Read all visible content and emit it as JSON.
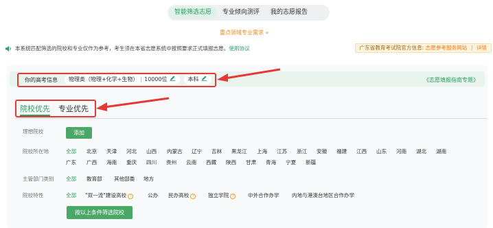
{
  "top_tabs": [
    {
      "label": "智能筛选志愿",
      "active": true
    },
    {
      "label": "专业倾向测评",
      "active": false
    },
    {
      "label": "我的志愿报告",
      "active": false
    }
  ],
  "promo_text": "重点领域专业需求 »",
  "notice": {
    "text": "本系统匹配筛选的院校和专业仅作为参考，考生须在本省志愿系统中按照要求正式填报志愿。",
    "link": "使用协议"
  },
  "official": {
    "prefix": "广东省教育考试院官方信息:",
    "link1": "志愿参考服务网站",
    "sep": "|",
    "link2": "详情"
  },
  "exam_info": {
    "label": "你的高考信息",
    "subject": "物理类（物理+化学+生物）",
    "sep": "|",
    "rank": "10000位",
    "level": "本科"
  },
  "guide_link": "《志愿填报指南专题》",
  "mode_tabs": [
    {
      "label": "院校优先",
      "active": true
    },
    {
      "label": "专业优先",
      "active": false
    }
  ],
  "ideal": {
    "label": "理想院校",
    "button": "添加"
  },
  "location": {
    "label": "院校所在地",
    "row1": [
      "全部",
      "北京",
      "天津",
      "河北",
      "山西",
      "内蒙古",
      "辽宁",
      "吉林",
      "黑龙江",
      "上海",
      "江苏",
      "浙江",
      "安徽",
      "福建",
      "江西",
      "山东",
      "河南",
      "湖北",
      "湖南"
    ],
    "row2": [
      "广东",
      "广西",
      "海南",
      "重庆",
      "四川",
      "贵州",
      "云南",
      "西藏",
      "陕西",
      "甘肃",
      "青海",
      "宁夏",
      "新疆"
    ]
  },
  "department": {
    "label": "主管部门类别",
    "options": [
      "全部",
      "教育部",
      "其他部委",
      "地方"
    ]
  },
  "features": {
    "label": "院校特性",
    "options": [
      "全部",
      "\"双一流\"建设高校",
      "公办",
      "民办高校",
      "独立学院",
      "中外合作办学",
      "内地与港澳台地区合作办学"
    ]
  },
  "filter_button": "按以上条件筛选院校",
  "colors": {
    "accent": "#2f9b64",
    "button": "#4aa867",
    "highlight": "#e53935",
    "warning": "#ef7c1a"
  }
}
